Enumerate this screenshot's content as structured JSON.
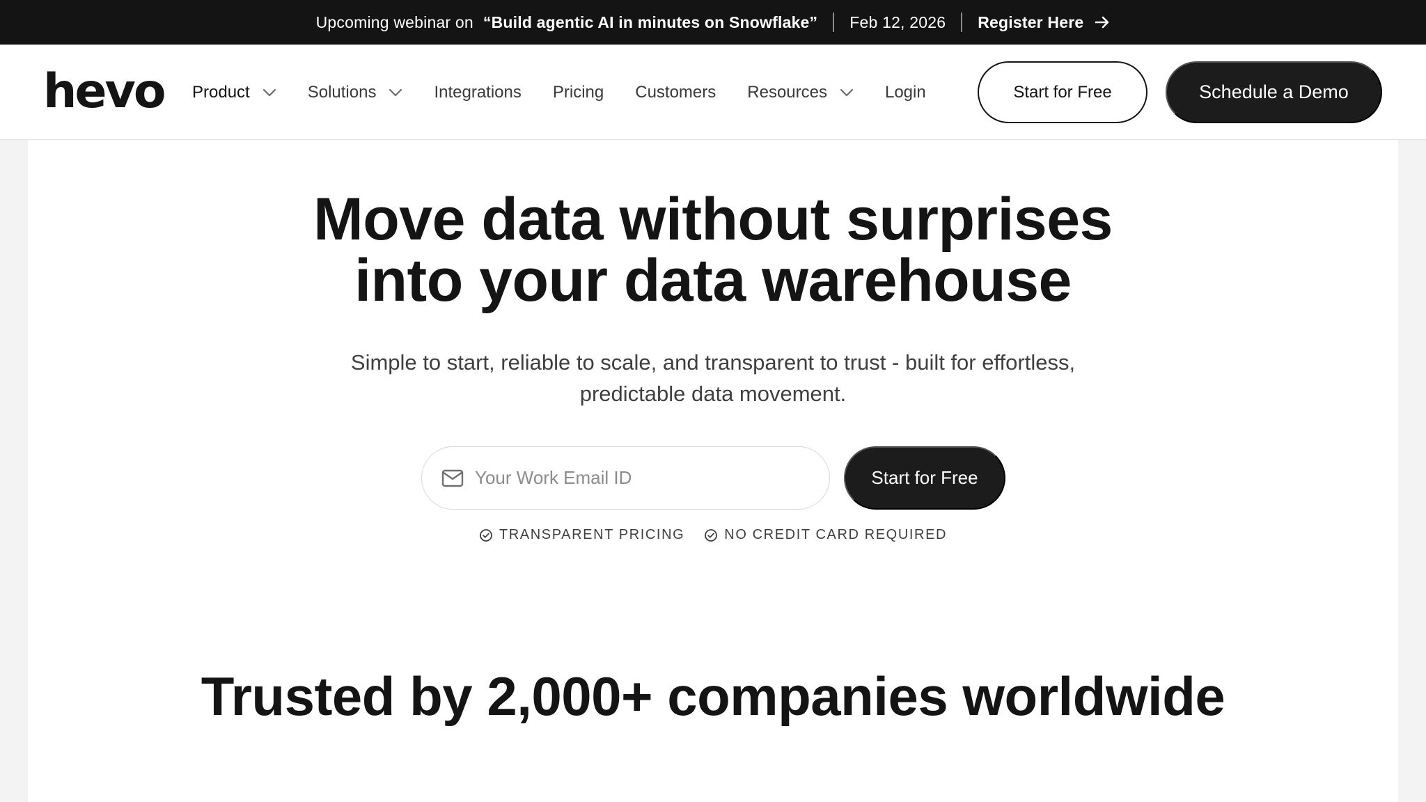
{
  "announcement": {
    "lead": "Upcoming webinar on",
    "title": "“Build agentic AI in minutes on Snowflake”",
    "date": "Feb 12, 2026",
    "cta": "Register Here",
    "cta_icon": "arrow-right-icon"
  },
  "header": {
    "logo": "hevo",
    "nav": [
      {
        "label": "Product",
        "has_dropdown": true
      },
      {
        "label": "Solutions",
        "has_dropdown": true
      },
      {
        "label": "Integrations",
        "has_dropdown": false
      },
      {
        "label": "Pricing",
        "has_dropdown": false
      },
      {
        "label": "Customers",
        "has_dropdown": false
      },
      {
        "label": "Resources",
        "has_dropdown": true
      },
      {
        "label": "Login",
        "has_dropdown": false
      }
    ],
    "start_free": "Start for Free",
    "schedule_demo": "Schedule a Demo"
  },
  "hero": {
    "title_line1": "Move data without surprises",
    "title_line2": "into your data warehouse",
    "subtitle_line1": "Simple to start, reliable to scale, and transparent to trust - built for effortless,",
    "subtitle_line2": "predictable data movement.",
    "email_placeholder": "Your Work Email ID",
    "email_value": "",
    "cta": "Start for Free",
    "badges": [
      "TRANSPARENT PRICING",
      "NO CREDIT CARD REQUIRED"
    ]
  },
  "trusted": {
    "title": "Trusted by 2,000+ companies worldwide"
  },
  "colors": {
    "dark": "#141414",
    "button_dark": "#1c1c1c",
    "page_bg": "#f3f3f3",
    "card_bg": "#ffffff"
  }
}
